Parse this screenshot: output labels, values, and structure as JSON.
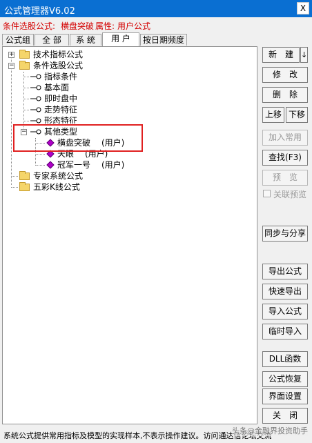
{
  "window": {
    "title": "公式管理器V6.02",
    "close_glyph": "X"
  },
  "info": {
    "prefix": "条件选股公式:",
    "formula_name": "横盘突破",
    "attr_label": "属性:",
    "attr_value": "用户公式"
  },
  "tabs": [
    "公式组",
    "全 部",
    "系 统",
    "用 户",
    "按日期频度"
  ],
  "active_tab": "用 户",
  "tree": {
    "tech_indicator": "技术指标公式",
    "condition_select": "条件选股公式",
    "children": [
      "指标条件",
      "基本面",
      "即时盘中",
      "走势特征",
      "形态特征"
    ],
    "other_type": "其他类型",
    "other_children": [
      {
        "name": "横盘突破",
        "tag": "(用户)"
      },
      {
        "name": "天眼",
        "tag": "(用户)"
      },
      {
        "name": "冠军一号",
        "tag": "(用户)"
      }
    ],
    "expert_system": "专家系统公式",
    "five_color_k": "五彩K线公式"
  },
  "buttons": {
    "new": "新　建",
    "new_arrow": "↓",
    "modify": "修　改",
    "delete": "删　除",
    "move_up": "上移",
    "move_down": "下移",
    "add_common": "加入常用",
    "find": "查找(F3)",
    "preview": "预　览",
    "related_preview": "关联预览",
    "sync_share": "同步与分享",
    "export_formula": "导出公式",
    "quick_export": "快速导出",
    "import_formula": "导入公式",
    "temp_import": "临时导入",
    "dll_func": "DLL函数",
    "formula_restore": "公式恢复",
    "ui_settings": "界面设置",
    "close": "关　闭"
  },
  "status": {
    "text": "系统公式提供常用指标及模型的实现样本,不表示操作建议。访问通达信论坛交流"
  },
  "watermark": "头条@金融界投资助手",
  "colors": {
    "titlebar": "#0a6fd2",
    "info_text": "#d40000",
    "highlight_box": "#e02020",
    "diamond": "#b000c8"
  }
}
